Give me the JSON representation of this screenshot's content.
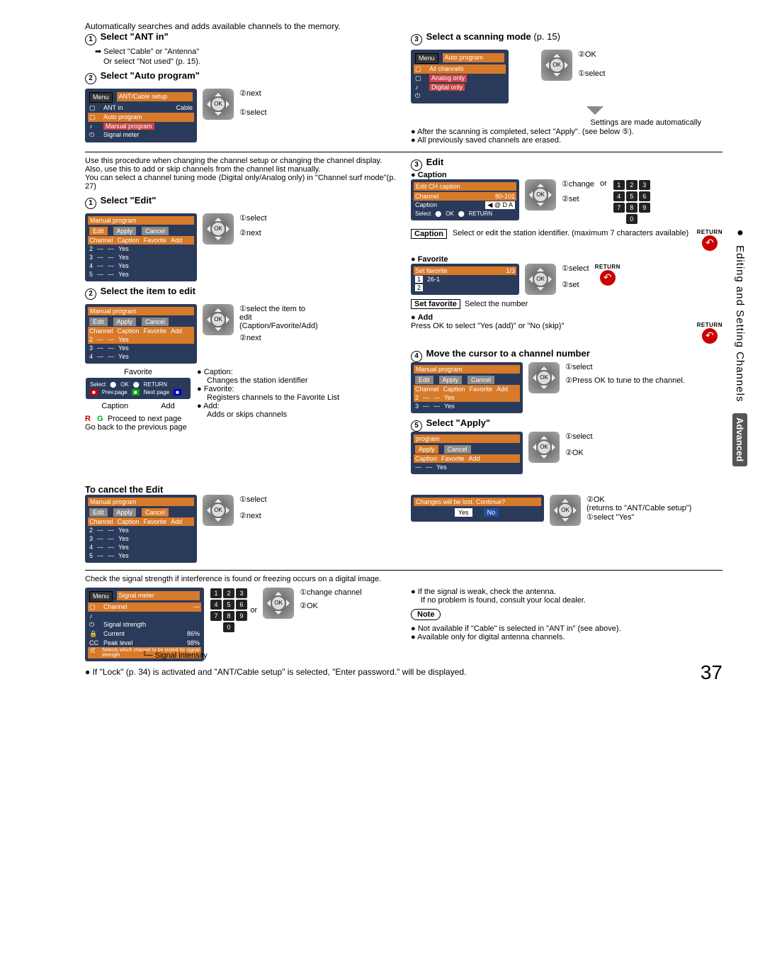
{
  "pageNumber": "37",
  "sideTab": {
    "main": "Editing and Setting Channels",
    "adv": "Advanced"
  },
  "intro": "Automatically searches and adds available channels to the memory.",
  "s1": {
    "title": "Select \"ANT in\"",
    "l1": "Select \"Cable\" or \"Antenna\"",
    "l2": "Or select \"Not used\" (p. 15)."
  },
  "s2": {
    "title": "Select \"Auto program\""
  },
  "osd1": {
    "menu": "Menu",
    "ttl": "ANT/Cable setup",
    "r1a": "ANT in",
    "r1b": "Cable",
    "r2": "Auto program",
    "r3": "Manual program",
    "r4": "Signal meter"
  },
  "lbl": {
    "next": "next",
    "select": "select",
    "ok": "OK",
    "set": "set",
    "change": "change",
    "or": "or",
    "changeChannel": "change channel",
    "selectItem": "select the item to edit (Caption/Favorite/Add)",
    "pressOkTune": "Press OK to tune to the channel.",
    "returnsAnt": "(returns to \"ANT/Cable setup\")",
    "selectYes": "select \"Yes\""
  },
  "s3": {
    "title": "Select a scanning mode",
    "ref": "(p. 15)",
    "osd": {
      "menu": "Menu",
      "ttl": "Auto program",
      "r1": "All channels",
      "r2": "Analog only",
      "r3": "Digital only"
    },
    "n1": "Settings are made automatically",
    "b1": "After the scanning is completed, select \"Apply\". (see below ⑤).",
    "b2": "All previously saved channels are erased."
  },
  "manualIntro": {
    "p1": "Use this procedure when changing the channel setup or changing the channel display.",
    "p2": "Also, use this to add or skip channels from the channel list manually.",
    "p3": "You can select a channel tuning mode (Digital only/Analog only) in \"Channel surf mode\"(p. 27)"
  },
  "m1": {
    "title": "Select \"Edit\""
  },
  "osdMP": {
    "ttl": "Manual program",
    "tabE": "Edit",
    "tabA": "Apply",
    "tabC": "Cancel",
    "hCh": "Channel",
    "hCa": "Caption",
    "hFa": "Favorite",
    "hAd": "Add",
    "dots": "---",
    "yes": "Yes"
  },
  "m2": {
    "title": "Select the item to edit",
    "favLbl": "Favorite",
    "capLbl": "Caption",
    "addLbl": "Add",
    "capTxt": "Caption:",
    "capD": "Changes the station identifier",
    "favTxt": "Favorite:",
    "favD": "Registers channels to the Favorite List",
    "addTxt": "Add:",
    "addD": "Adds or skips channels"
  },
  "rg": {
    "R": "R",
    "G": "G",
    "goBack": "Go back to the previous page",
    "proceed": "Proceed to next page",
    "prev": "Prev.page",
    "nxt": "Next page",
    "selectOK": "OK",
    "ret": "RETURN",
    "sel": "Select"
  },
  "m3": {
    "title": "Edit",
    "caption": "Caption",
    "osdC": {
      "ttl": "Edit CH caption",
      "r1": "Channel",
      "r1v": "80-101",
      "r2": "Caption",
      "r2v": "◀ @ D A"
    },
    "capBox": "Caption",
    "capTxt": "Select or edit the station identifier. (maximum 7 characters available)",
    "fav": "Favorite",
    "osdF": {
      "ttl": "Set favorite",
      "pg": "1/3",
      "c1": "26-1"
    },
    "setFav": "Set favorite",
    "setFavTxt": "Select the number",
    "add": "Add",
    "addTxt": "Press OK to select \"Yes (add)\" or \"No (skip)\"",
    "return": "RETURN"
  },
  "m4": {
    "title": "Move the cursor to a channel number"
  },
  "m5": {
    "title": "Select \"Apply\"",
    "osd": {
      "ttl": "program",
      "tabA": "Apply",
      "tabC": "Cancel"
    }
  },
  "cancel": {
    "title": "To cancel the Edit",
    "osdQ": {
      "q": "Changes will be lost. Continue?",
      "yes": "Yes",
      "no": "No"
    }
  },
  "signal": {
    "intro": "Check the signal strength if interference is found or freezing occurs on a digital image.",
    "osd": {
      "menu": "Menu",
      "ttl": "Signal meter",
      "ch": "Channel",
      "ss": "Signal strength",
      "cur": "Current",
      "curV": "86%",
      "peak": "Peak level",
      "peakV": "98%",
      "desc": "Selects which channel to be tested for signal strength"
    },
    "si": "Signal intensity",
    "b1": "If the signal is weak, check the antenna.",
    "b1b": "If no problem is found, consult your local dealer.",
    "note": "Note",
    "n1": "Not available if \"Cable\" is selected in \"ANT in\" (see above).",
    "n2": "Available only for digital antenna channels."
  },
  "footnote": "If \"Lock\" (p. 34) is activated and \"ANT/Cable setup\" is selected, \"Enter password.\" will be displayed."
}
